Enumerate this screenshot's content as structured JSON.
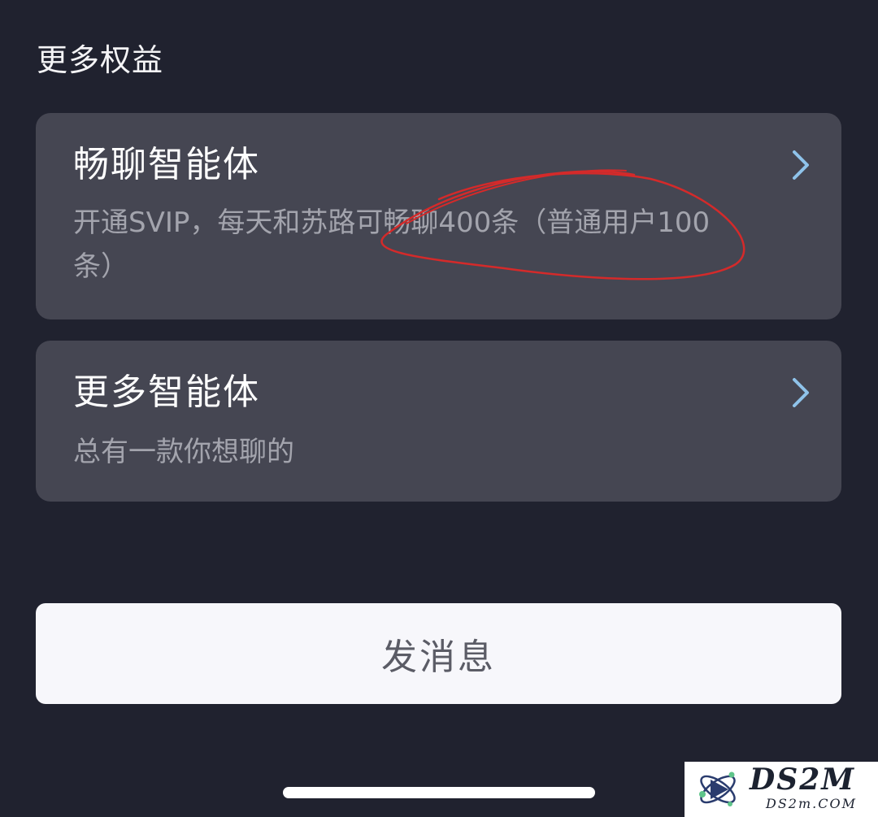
{
  "section": {
    "title": "更多权益"
  },
  "cards": [
    {
      "title": "畅聊智能体",
      "description": "开通SVIP，每天和苏路可畅聊400条（普通用户100条）",
      "icon": "chevron-right-icon"
    },
    {
      "title": "更多智能体",
      "description": "总有一款你想聊的",
      "icon": "chevron-right-icon"
    }
  ],
  "actions": {
    "send_label": "发消息"
  },
  "watermark": {
    "main": "DS2M",
    "sub": "DS2m.COM"
  },
  "colors": {
    "background": "#20222f",
    "card": "#454652",
    "chevron": "#8fc3ea",
    "annotation": "#d42a2a",
    "button": "#f7f7fb"
  }
}
